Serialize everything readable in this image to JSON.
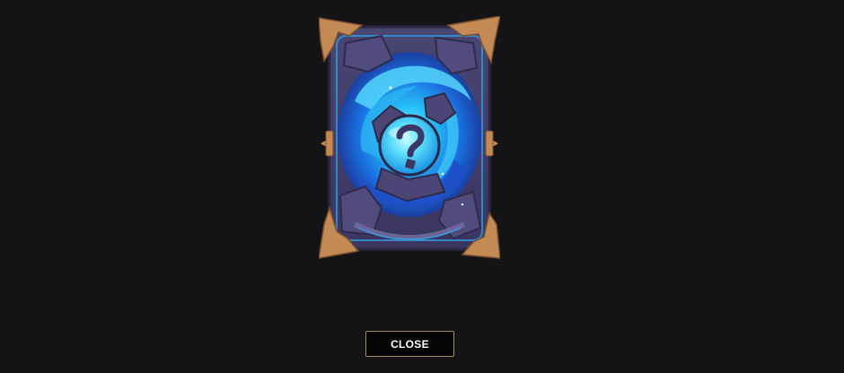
{
  "card": {
    "state": "unrevealed",
    "glyph": "question-mark-icon",
    "frame_color": "#45406a",
    "swirl_color": "#1fa6f0",
    "corner_color": "#c48a56"
  },
  "actions": {
    "close_label": "CLOSE"
  }
}
